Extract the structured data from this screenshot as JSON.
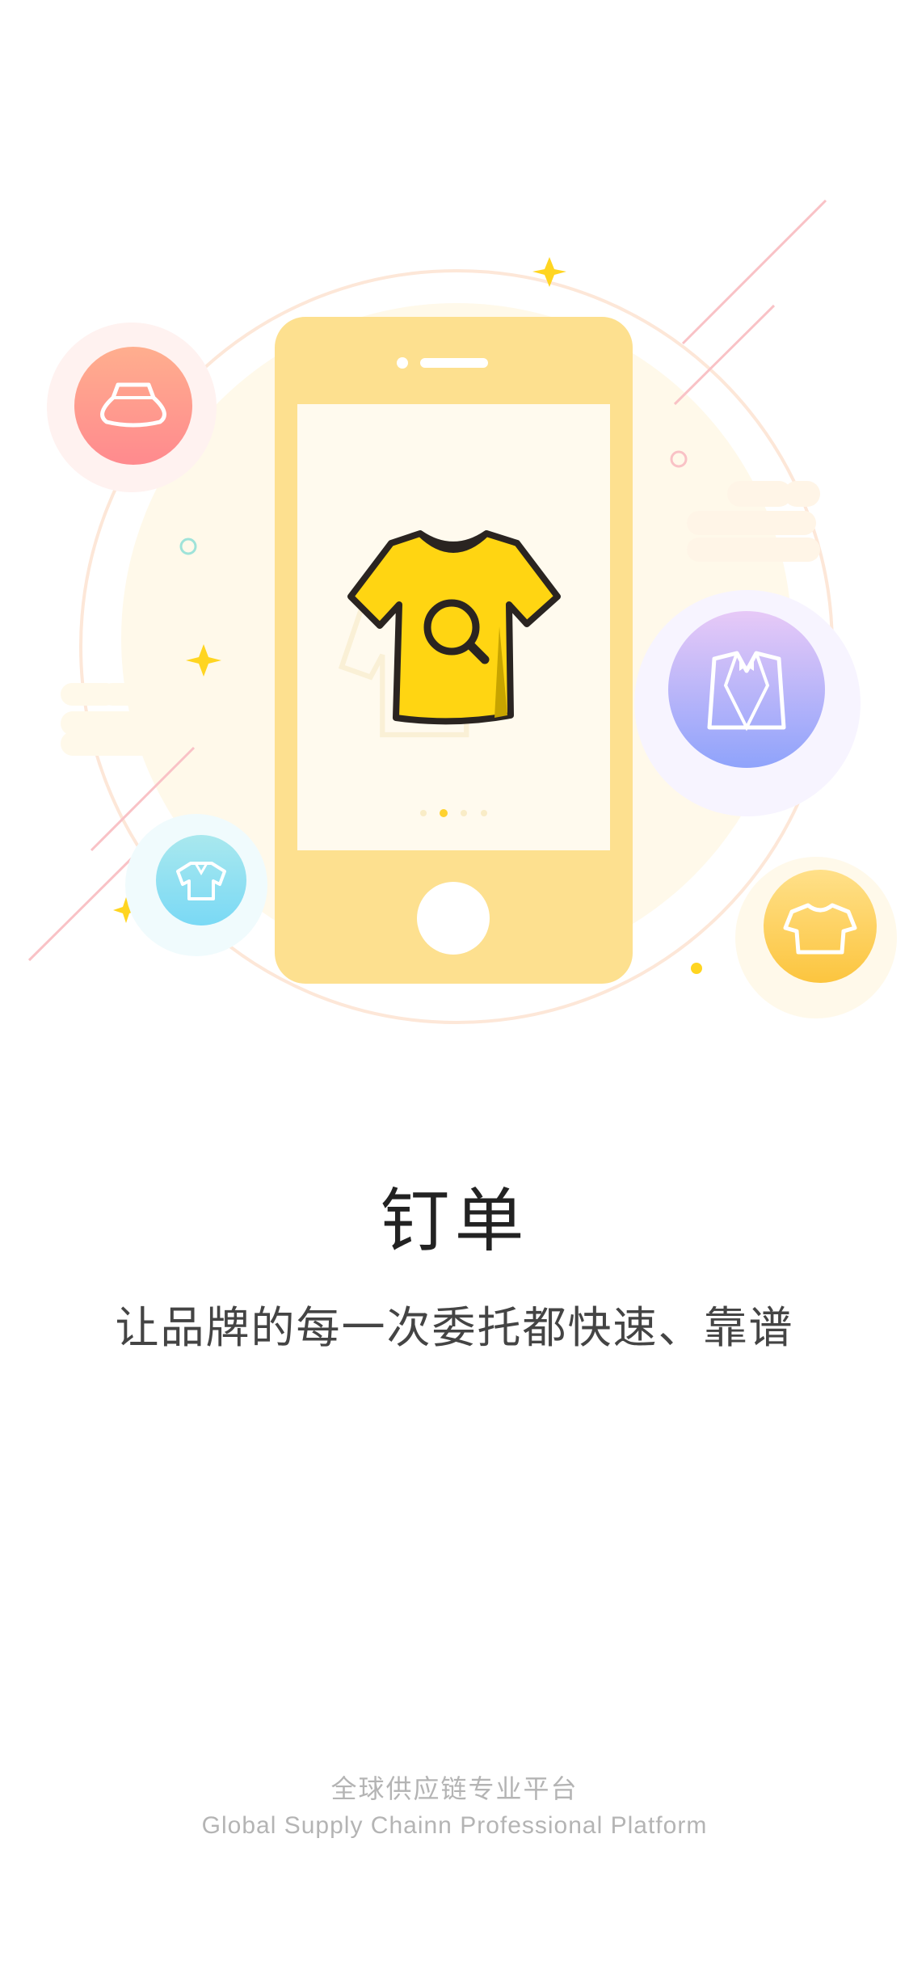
{
  "onboarding": {
    "title": "钉单",
    "subtitle": "让品牌的每一次委托都快速、靠谱",
    "page_indicator": {
      "total": 4,
      "active_index": 1
    },
    "icons": [
      "skirt-icon",
      "suit-icon",
      "shirt-icon",
      "tshirt-icon",
      "tshirt-search-icon"
    ]
  },
  "footer": {
    "tagline_cn": "全球供应链专业平台",
    "tagline_en": "Global Supply Chainn Professional Platform"
  },
  "colors": {
    "phone_body": "#fde08f",
    "screen": "#fffaee",
    "shirt": "#ffd512",
    "text_dark": "#222222",
    "text_light": "#b4b4b4",
    "accent_pink": "#ff8b88",
    "accent_blue": "#8f9df8",
    "accent_cyan": "#7dd9f2",
    "accent_yellow": "#fcc844"
  }
}
